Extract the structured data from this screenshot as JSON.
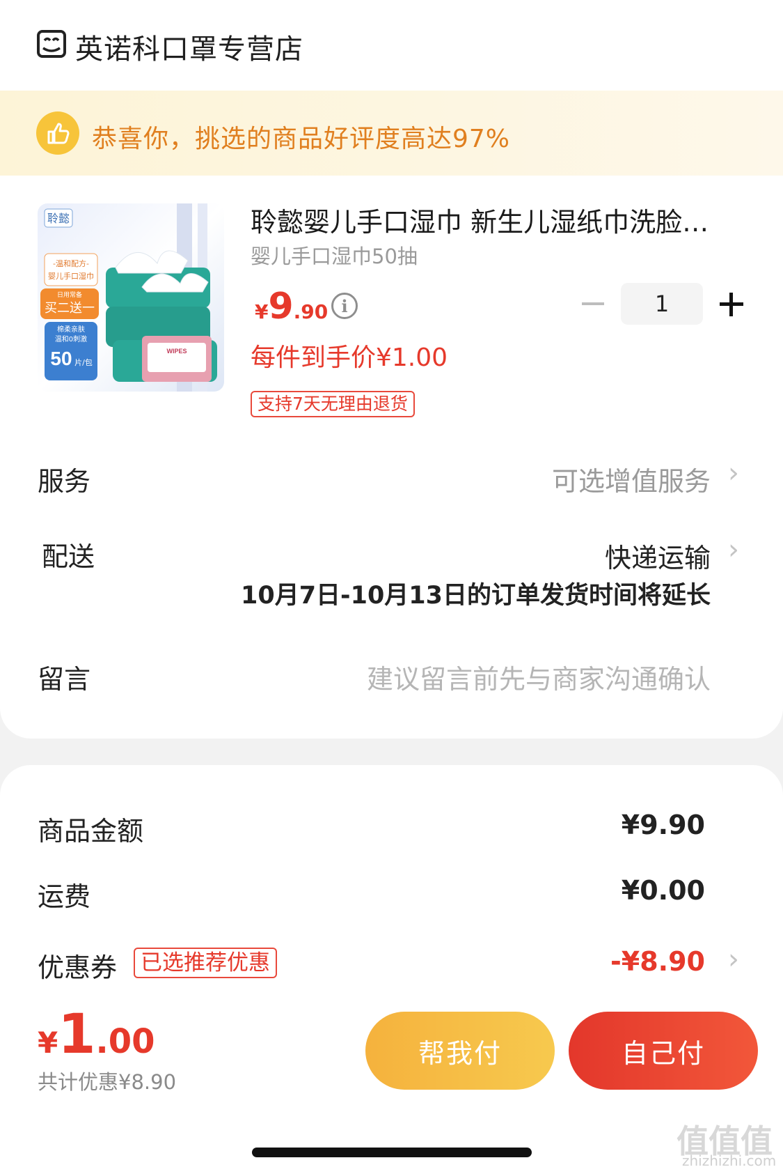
{
  "store": {
    "name": "英诺科口罩专营店",
    "icon": "store-icon"
  },
  "banner": {
    "text": "恭喜你，挑选的商品好评度高达97%",
    "icon": "thumbs-up-icon"
  },
  "product": {
    "title": "聆懿婴儿手口湿巾 新生儿湿纸巾洗脸…",
    "subtitle": "婴儿手口湿巾50抽",
    "price_currency": "¥",
    "price_int": "9",
    "price_dec": ".90",
    "per_price": "每件到手价¥1.00",
    "return_tag": "支持7天无理由退货",
    "quantity": "1",
    "image_labels": {
      "brand": "聆懿",
      "formula": "-温和配方-",
      "type": "婴儿手口湿巾",
      "daily": "日用常备",
      "promo": "买二送一",
      "soft": "棉柔亲肤",
      "gentle": "温和0刺激",
      "count": "50",
      "unit": "片/包",
      "pack_word": "WIPES"
    }
  },
  "service": {
    "label": "服务",
    "value": "可选增值服务"
  },
  "delivery": {
    "label": "配送",
    "value": "快递运输",
    "notice": "10月7日-10月13日的订单发货时间将延长"
  },
  "message": {
    "label": "留言",
    "placeholder": "建议留言前先与商家沟通确认"
  },
  "summary": {
    "goods_label": "商品金额",
    "goods_value": "¥9.90",
    "shipping_label": "运费",
    "shipping_value": "¥0.00",
    "coupon_label": "优惠券",
    "coupon_tag": "已选推荐优惠",
    "coupon_value": "-¥8.90"
  },
  "footer": {
    "total_currency": "¥",
    "total_int": "1",
    "total_dec": ".00",
    "saved": "共计优惠¥8.90",
    "help_pay": "帮我付",
    "self_pay": "自己付"
  },
  "watermark": {
    "text": "值值值",
    "url": "zhizhizhi.com"
  }
}
